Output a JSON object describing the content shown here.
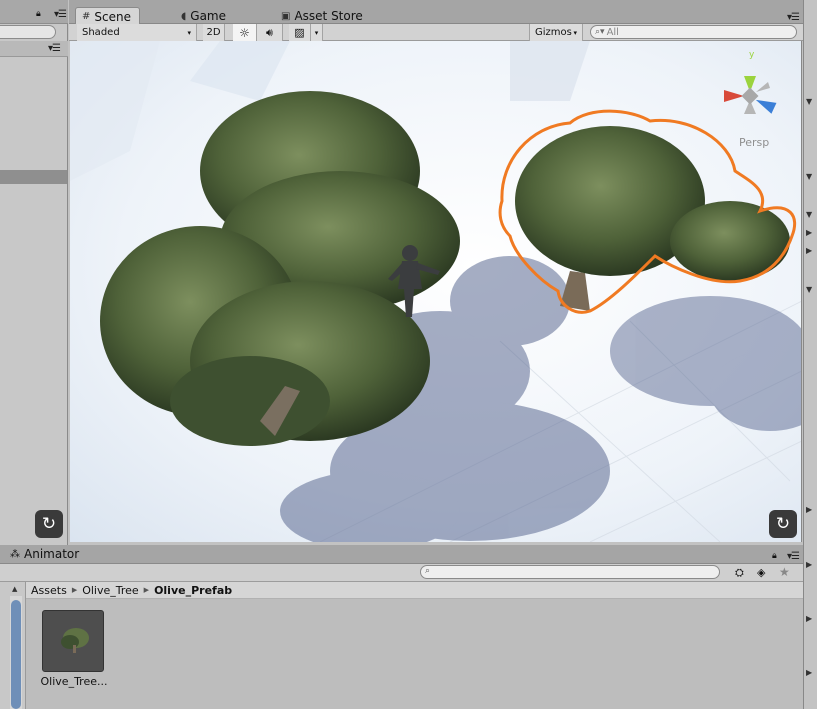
{
  "scene_tabs": [
    {
      "label": "Scene",
      "icon": "grid-icon"
    },
    {
      "label": "Game",
      "icon": "pacman-icon"
    },
    {
      "label": "Asset Store",
      "icon": "bag-icon"
    }
  ],
  "toolbar": {
    "shading_mode": "Shaded",
    "mode_2d": "2D",
    "gizmos_label": "Gizmos",
    "search_placeholder": "All"
  },
  "scene_gizmo": {
    "projection_label": "Persp",
    "axis_y": "y",
    "colors": {
      "x": "#d84a3a",
      "y": "#9bd33d",
      "z": "#3b7fd7"
    }
  },
  "animator_tab": {
    "label": "Animator"
  },
  "project": {
    "breadcrumb": [
      "Assets",
      "Olive_Tree",
      "Olive_Prefab"
    ],
    "assets": [
      {
        "label": "Olive_Tree..."
      }
    ]
  },
  "selection_outline_color": "#f07a22"
}
